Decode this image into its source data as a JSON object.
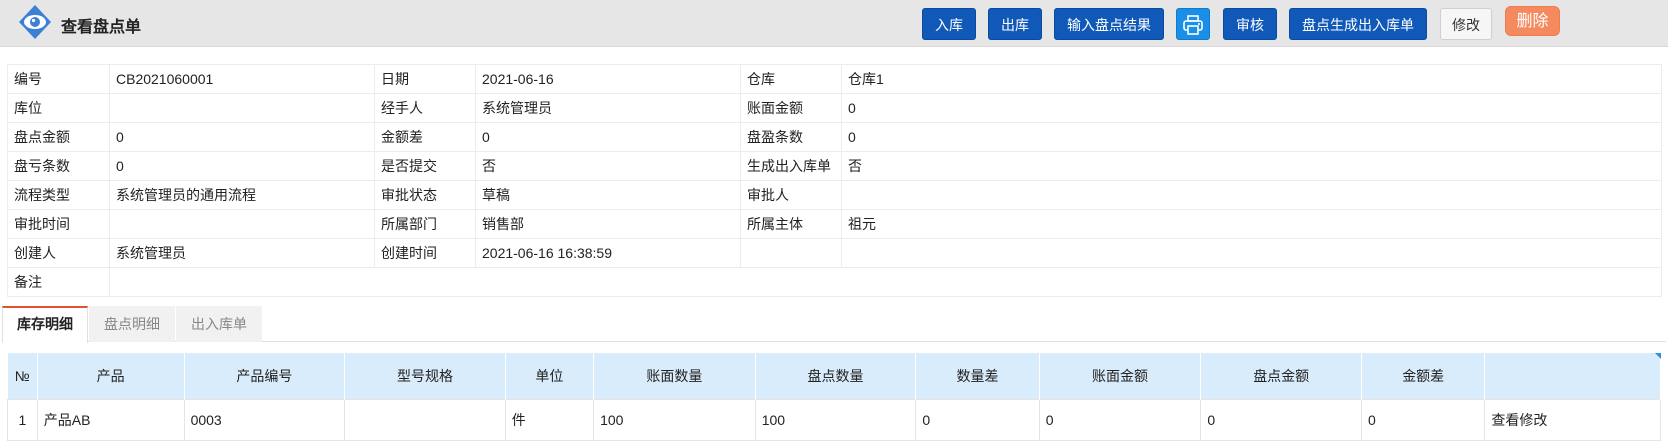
{
  "header": {
    "title": "查看盘点单",
    "buttons": {
      "in_stock": "入库",
      "out_stock": "出库",
      "input_result": "输入盘点结果",
      "audit": "审核",
      "generate": "盘点生成出入库单",
      "edit": "修改",
      "delete": "删除"
    }
  },
  "info": {
    "rows": [
      [
        {
          "label": "编号",
          "value": "CB2021060001"
        },
        {
          "label": "日期",
          "value": "2021-06-16"
        },
        {
          "label": "仓库",
          "value": "仓库1"
        }
      ],
      [
        {
          "label": "库位",
          "value": ""
        },
        {
          "label": "经手人",
          "value": "系统管理员"
        },
        {
          "label": "账面金额",
          "value": "0"
        }
      ],
      [
        {
          "label": "盘点金额",
          "value": "0"
        },
        {
          "label": "金额差",
          "value": "0"
        },
        {
          "label": "盘盈条数",
          "value": "0"
        }
      ],
      [
        {
          "label": "盘亏条数",
          "value": "0"
        },
        {
          "label": "是否提交",
          "value": "否"
        },
        {
          "label": "生成出入库单",
          "value": "否"
        }
      ],
      [
        {
          "label": "流程类型",
          "value": "系统管理员的通用流程"
        },
        {
          "label": "审批状态",
          "value": "草稿"
        },
        {
          "label": "审批人",
          "value": ""
        }
      ],
      [
        {
          "label": "审批时间",
          "value": ""
        },
        {
          "label": "所属部门",
          "value": "销售部"
        },
        {
          "label": "所属主体",
          "value": "祖元"
        }
      ],
      [
        {
          "label": "创建人",
          "value": "系统管理员"
        },
        {
          "label": "创建时间",
          "value": "2021-06-16 16:38:59"
        },
        {
          "label": "",
          "value": ""
        }
      ]
    ],
    "remark": {
      "label": "备注",
      "value": ""
    }
  },
  "tabs": [
    "库存明细",
    "盘点明细",
    "出入库单"
  ],
  "grid": {
    "columns": [
      "№",
      "产品",
      "产品编号",
      "型号规格",
      "单位",
      "账面数量",
      "盘点数量",
      "数量差",
      "账面金额",
      "盘点金额",
      "金额差",
      ""
    ],
    "rows": [
      [
        "1",
        "产品AB",
        "0003",
        "",
        "件",
        "100",
        "100",
        "0",
        "0",
        "0",
        "0",
        "查看修改"
      ]
    ]
  },
  "colors": {
    "primary": "#1159b8",
    "print": "#1a8fea",
    "delete": "#f58a5f",
    "tab_accent": "#e2532b",
    "grid_header": "#d9ecfb",
    "link": "#1a6ed1"
  }
}
